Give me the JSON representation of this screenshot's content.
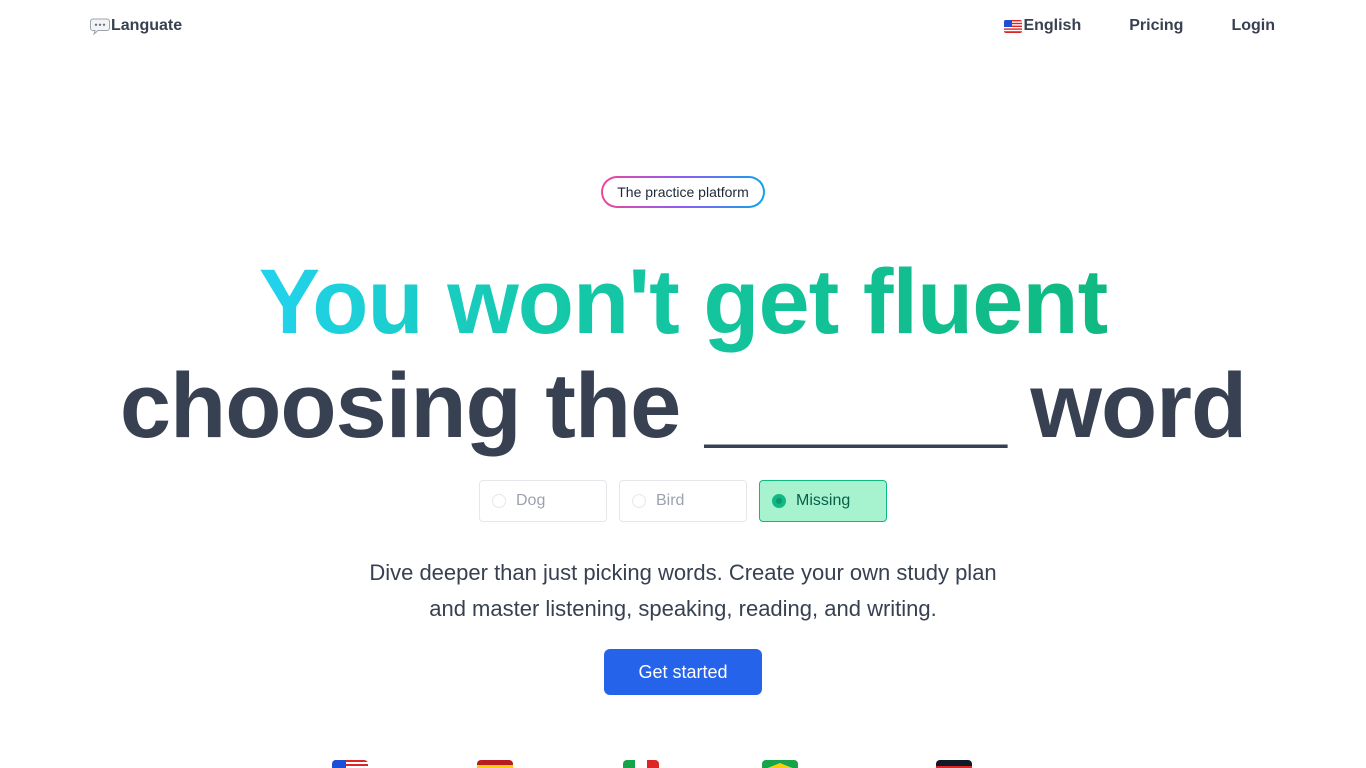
{
  "header": {
    "logo_text": "Languate",
    "logo_icon": "speech-bubble-icon",
    "nav": {
      "language_label": "English",
      "language_icon": "us-flag-icon",
      "pricing_label": "Pricing",
      "login_label": "Login"
    }
  },
  "hero": {
    "badge": "The practice platform",
    "headline_line1": "You won't get fluent",
    "headline_line2": "choosing the ______ word",
    "choices": [
      {
        "label": "Dog",
        "selected": false
      },
      {
        "label": "Bird",
        "selected": false
      },
      {
        "label": "Missing",
        "selected": true
      }
    ],
    "description_line1": "Dive deeper than just picking words. Create your own study plan",
    "description_line2": "and master listening, speaking, reading, and writing.",
    "cta_label": "Get started"
  },
  "language_flags": [
    "us-flag-icon",
    "spain-flag-icon",
    "italy-flag-icon",
    "brazil-flag-icon",
    "germany-flag-icon"
  ],
  "colors": {
    "accent_gradient_start": "#22d3ee",
    "accent_gradient_end": "#10b981",
    "primary_button": "#2563eb",
    "selected_choice_bg": "#a7f3d0",
    "text_dark": "#374151"
  }
}
